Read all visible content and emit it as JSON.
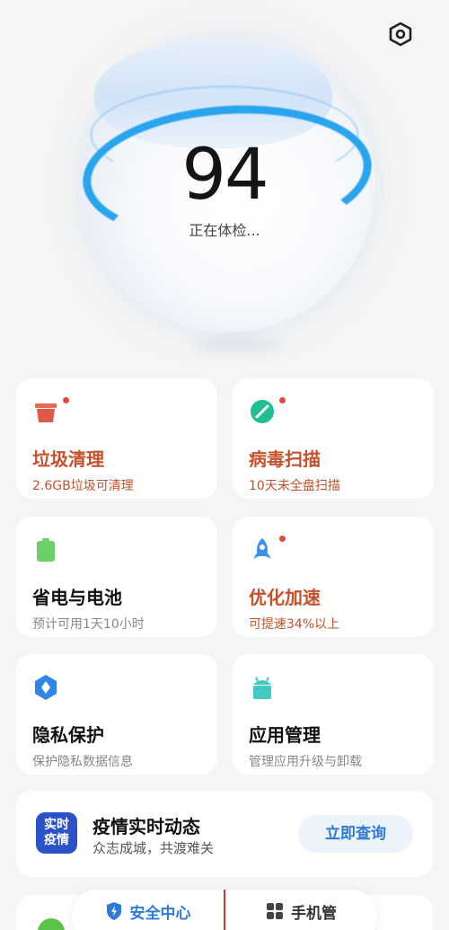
{
  "score": "94",
  "status": "正在体检...",
  "cards": [
    {
      "title": "垃圾清理",
      "sub": "2.6GB垃圾可清理",
      "icon": "trash-icon",
      "alert": true,
      "dot": true
    },
    {
      "title": "病毒扫描",
      "sub": "10天未全盘扫描",
      "icon": "virus-scan-icon",
      "alert": true,
      "dot": true
    },
    {
      "title": "省电与电池",
      "sub": "预计可用1天10小时",
      "icon": "battery-icon",
      "alert": false,
      "dot": false
    },
    {
      "title": "优化加速",
      "sub": "可提速34%以上",
      "icon": "rocket-icon",
      "alert": true,
      "dot": true
    },
    {
      "title": "隐私保护",
      "sub": "保护隐私数据信息",
      "icon": "privacy-shield-icon",
      "alert": false,
      "dot": false
    },
    {
      "title": "应用管理",
      "sub": "管理应用升级与卸载",
      "icon": "android-icon",
      "alert": false,
      "dot": false
    }
  ],
  "banner": {
    "logo_line1": "实时",
    "logo_line2": "疫情",
    "title": "疫情实时动态",
    "subtitle": "众志成城，共渡难关",
    "button": "立即查询"
  },
  "nav": {
    "security": "安全中心",
    "manager": "手机管"
  },
  "colors": {
    "accent": "#2e7ad9",
    "alert": "#c8502a",
    "ring": "#29a4ee",
    "dot": "#e8473f"
  }
}
